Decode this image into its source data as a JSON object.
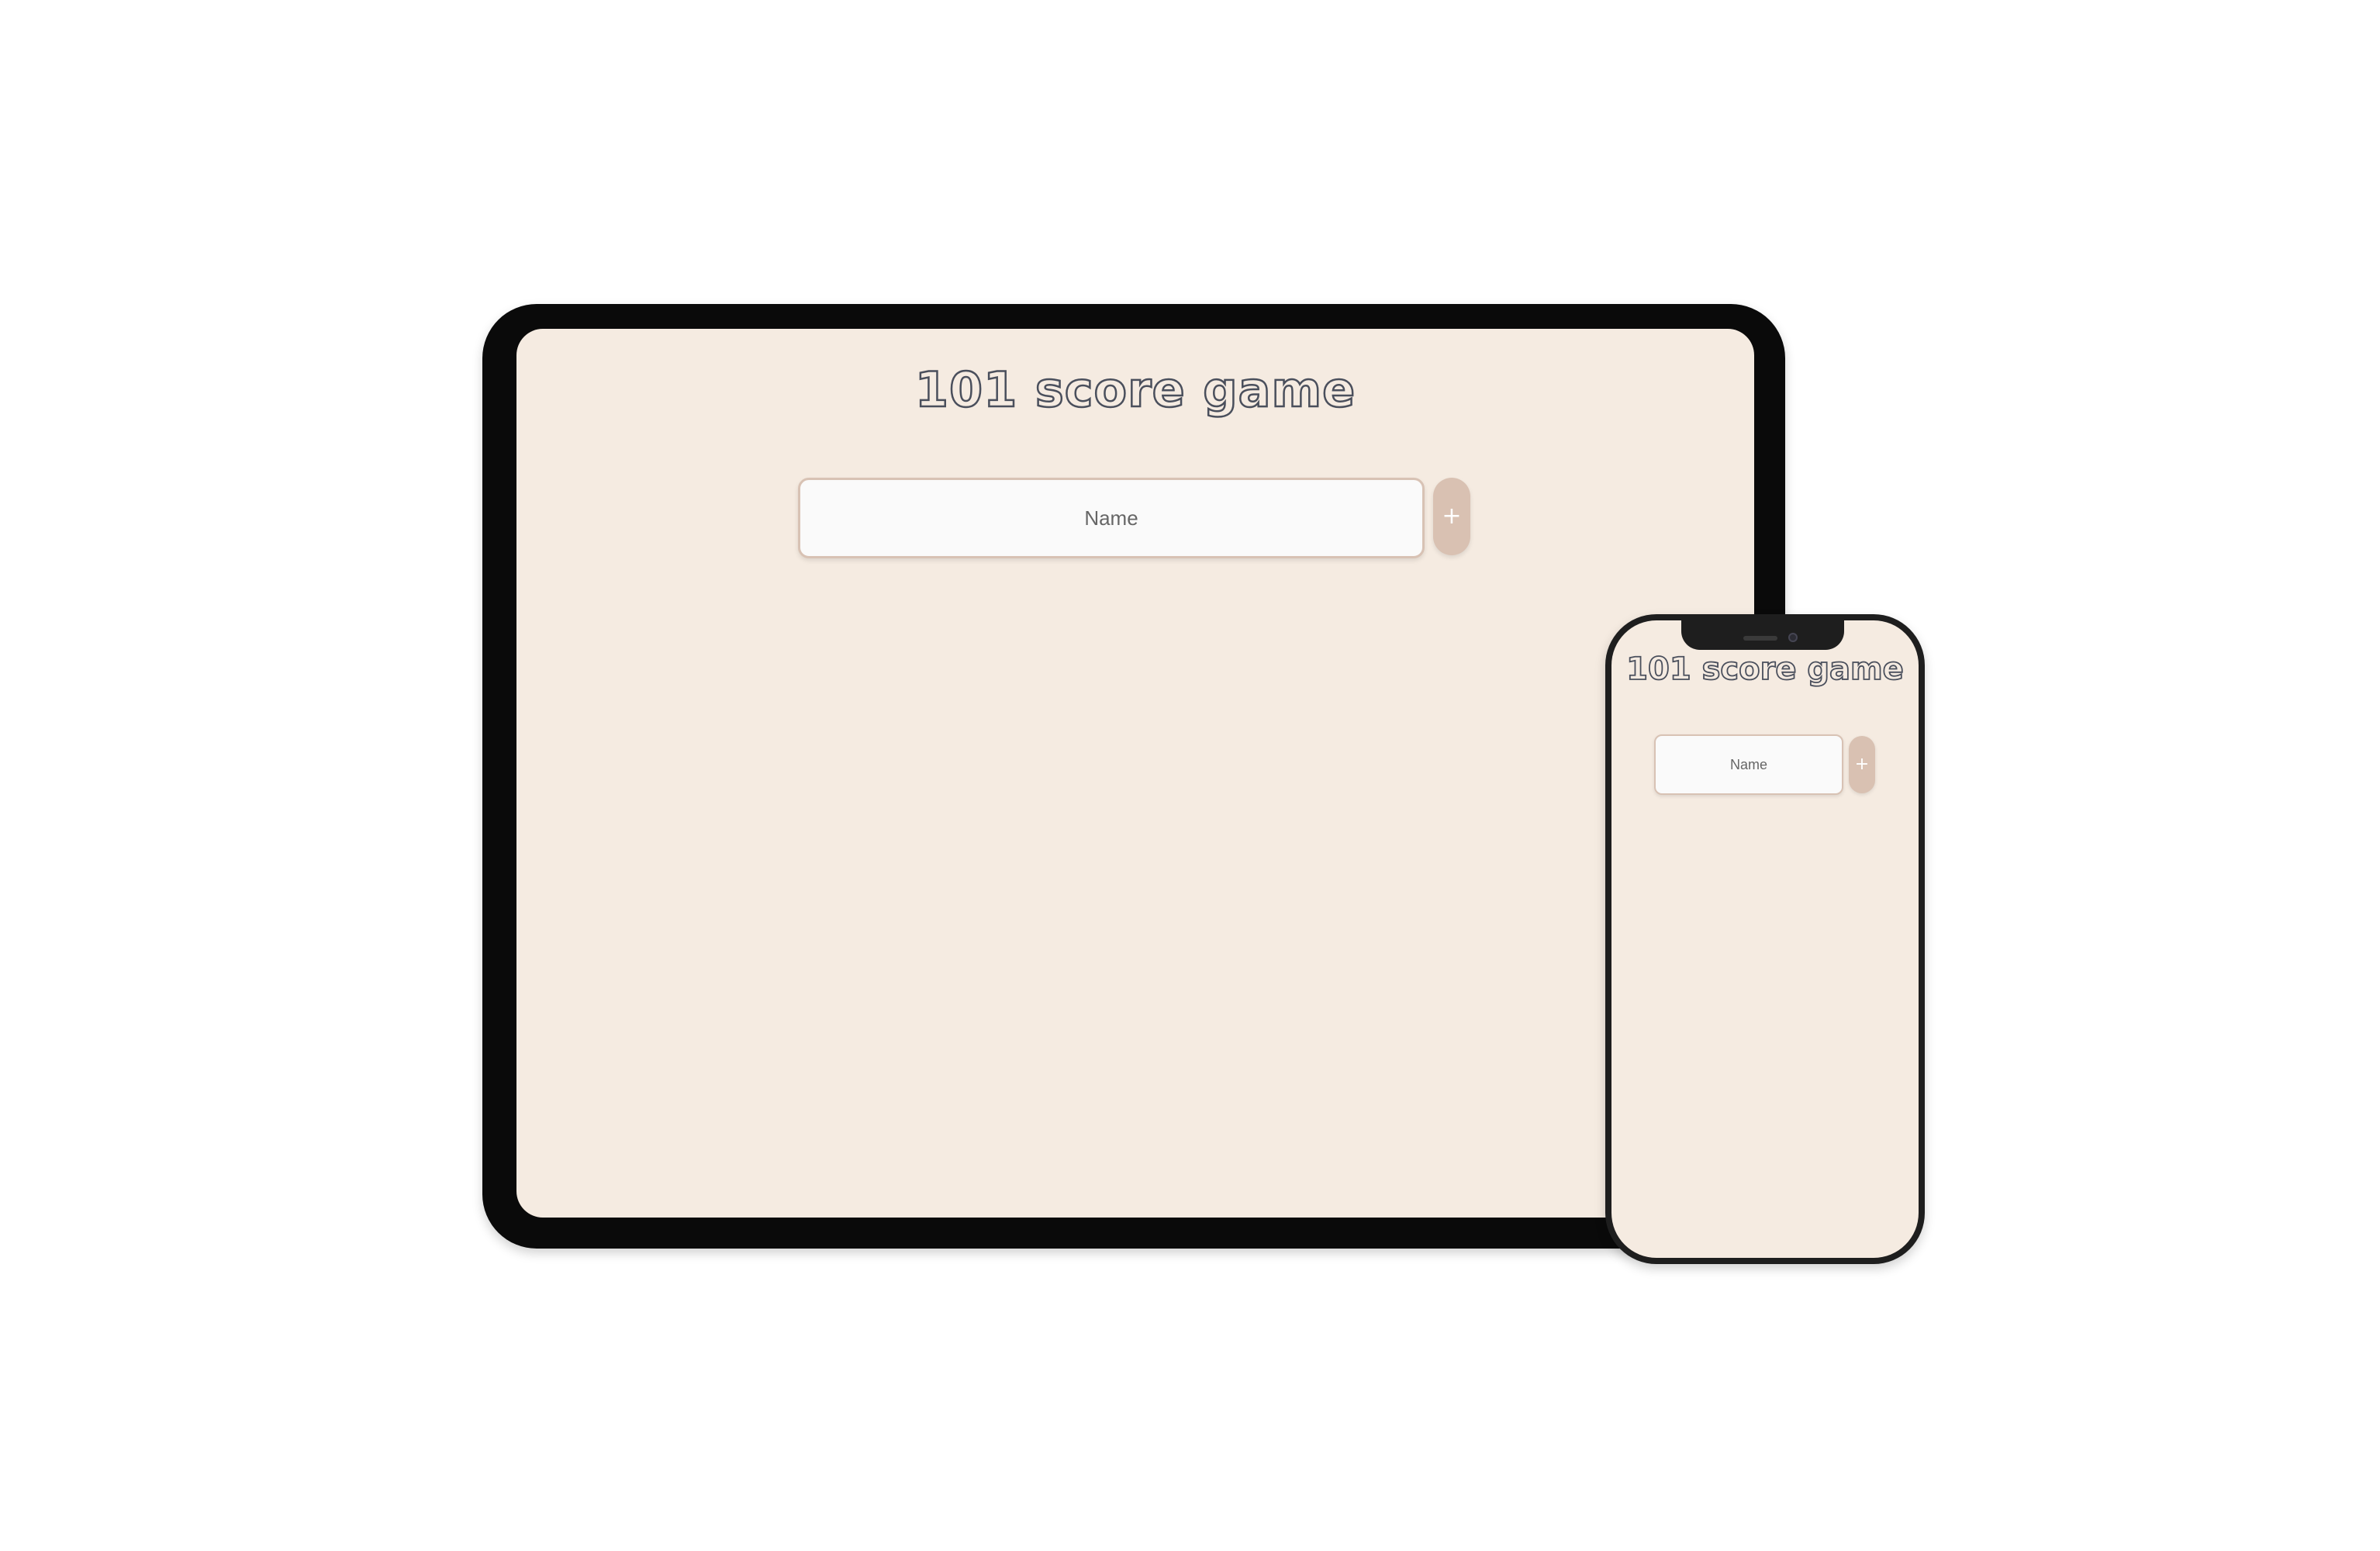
{
  "app": {
    "title": "101 score game",
    "name_placeholder": "Name",
    "add_label": "+"
  },
  "colors": {
    "screen_background": "#f5ebe1",
    "input_background": "#fafafa",
    "input_border": "#d8c2b4",
    "add_button": "#d9c1b2",
    "title_outline": "#4a4f5c",
    "device_frame": "#0a0a0a"
  }
}
